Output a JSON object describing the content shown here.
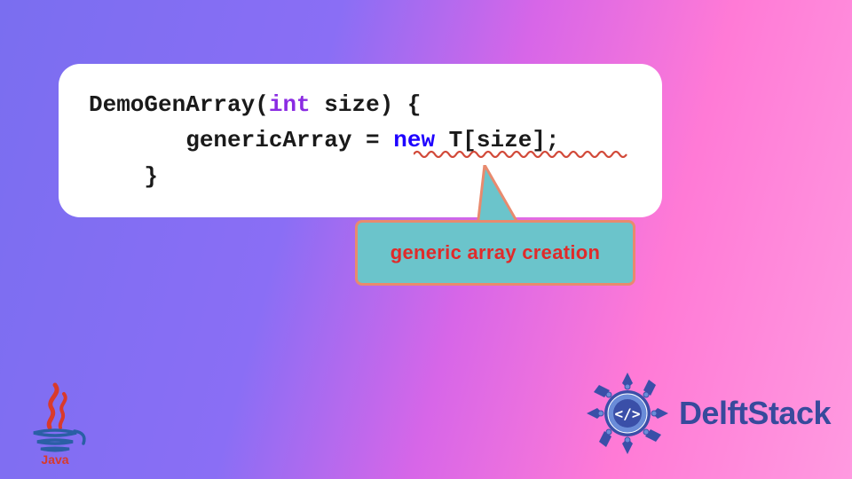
{
  "code": {
    "line1_pre": "DemoGenArray(",
    "line1_type": "int",
    "line1_post": " size) {",
    "line2_indent": "       genericArray = ",
    "line2_new": "new",
    "line2_post": " T[size];",
    "line3": "    }"
  },
  "callout": {
    "text": "generic array creation"
  },
  "logos": {
    "java_label": "Java",
    "delftstack": "DelftStack"
  },
  "colors": {
    "squiggle": "#d24a3a",
    "callout_bg": "#6bc4cb",
    "callout_border": "#e88a6e",
    "callout_text": "#e02a2a"
  }
}
